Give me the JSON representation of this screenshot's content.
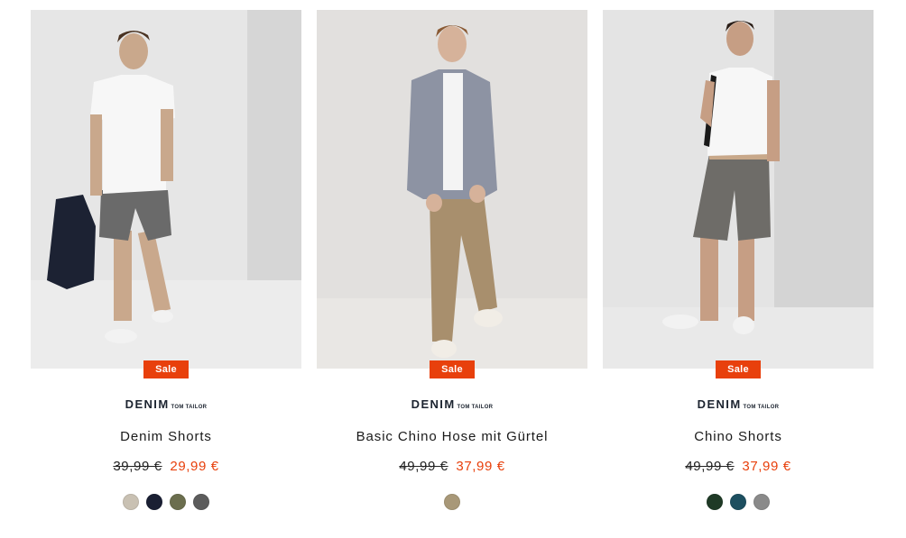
{
  "products": [
    {
      "badge": "Sale",
      "brand": {
        "main": "DENIM",
        "sub": "TOM TAILOR"
      },
      "name": "Denim Shorts",
      "price_old": "39,99 €",
      "price_new": "29,99 €",
      "swatches": [
        "#c9c1b3",
        "#1a1f33",
        "#6b6e4e",
        "#5c5c5c"
      ]
    },
    {
      "badge": "Sale",
      "brand": {
        "main": "DENIM",
        "sub": "TOM TAILOR"
      },
      "name": "Basic Chino Hose mit Gürtel",
      "price_old": "49,99 €",
      "price_new": "37,99 €",
      "swatches": [
        "#a89878"
      ]
    },
    {
      "badge": "Sale",
      "brand": {
        "main": "DENIM",
        "sub": "TOM TAILOR"
      },
      "name": "Chino Shorts",
      "price_old": "49,99 €",
      "price_new": "37,99 €",
      "swatches": [
        "#1f3a26",
        "#1d4f60",
        "#8a8a8a"
      ]
    }
  ],
  "colors": {
    "sale": "#e8400c",
    "text": "#1a1a1a"
  }
}
